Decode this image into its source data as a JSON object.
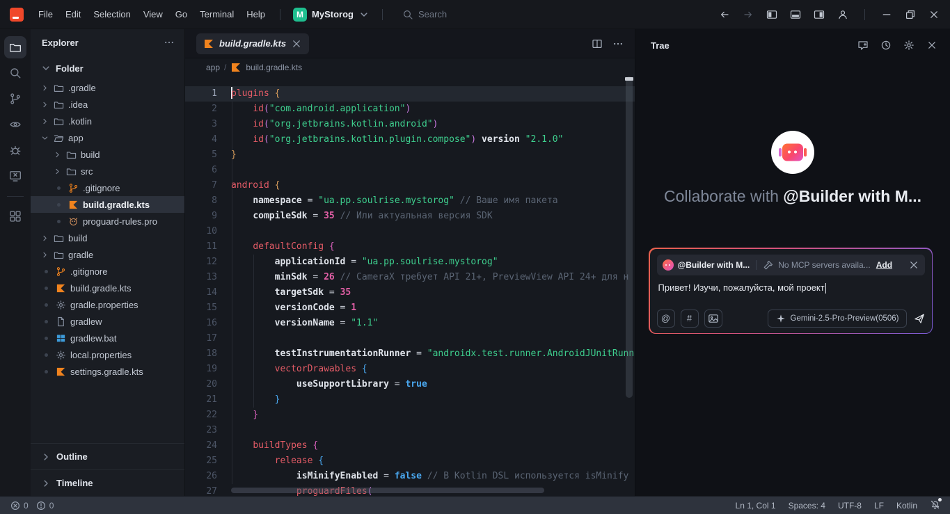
{
  "colors": {
    "accent_green": "#1fbf8f",
    "logo_red": "#f0482a",
    "kotlin_orange": "#f0831e",
    "windows_blue": "#3d9bd9",
    "input_border_gradient": [
      "#e8604c",
      "#d5527c",
      "#7a5bd6"
    ],
    "syntax": {
      "keyword": "#e35b66",
      "property": "#dfe3ea",
      "string": "#3ecf8e",
      "number": "#e25fa6",
      "comment": "#5a6473",
      "boolean": "#4aa8f0",
      "brace_level1": "#d49a5a",
      "brace_level2": "#d45fb8",
      "brace_level3": "#4aa8f0",
      "paren": "#c678dd"
    }
  },
  "titlebar": {
    "menus": [
      "File",
      "Edit",
      "Selection",
      "View",
      "Go",
      "Terminal",
      "Help"
    ],
    "project_badge": "M",
    "project_name": "MyStorog",
    "search_placeholder": "Search"
  },
  "activity_bar": {
    "items": [
      {
        "icon": "files-icon",
        "active": true
      },
      {
        "icon": "search-icon",
        "active": false
      },
      {
        "icon": "source-control-icon",
        "active": false
      },
      {
        "icon": "remote-eye-icon",
        "active": false
      },
      {
        "icon": "debug-icon",
        "active": false
      },
      {
        "icon": "test-screen-icon",
        "active": false
      },
      {
        "icon": "extensions-icon",
        "active": false,
        "below_divider": true
      }
    ]
  },
  "explorer": {
    "title": "Explorer",
    "section_label": "Folder",
    "items": [
      {
        "label": ".gradle",
        "icon": "folder",
        "level": 0,
        "kind": "folder"
      },
      {
        "label": ".idea",
        "icon": "folder",
        "level": 0,
        "kind": "folder"
      },
      {
        "label": ".kotlin",
        "icon": "folder",
        "level": 0,
        "kind": "folder"
      },
      {
        "label": "app",
        "icon": "folder-open",
        "level": 0,
        "kind": "folder",
        "expanded": true
      },
      {
        "label": "build",
        "icon": "folder",
        "level": 1,
        "kind": "folder"
      },
      {
        "label": "src",
        "icon": "folder",
        "level": 1,
        "kind": "folder"
      },
      {
        "label": ".gitignore",
        "icon": "git",
        "level": 1,
        "kind": "file"
      },
      {
        "label": "build.gradle.kts",
        "icon": "kotlin",
        "level": 1,
        "kind": "file",
        "selected": true
      },
      {
        "label": "proguard-rules.pro",
        "icon": "owl",
        "level": 1,
        "kind": "file"
      },
      {
        "label": "build",
        "icon": "folder",
        "level": 0,
        "kind": "folder"
      },
      {
        "label": "gradle",
        "icon": "folder",
        "level": 0,
        "kind": "folder"
      },
      {
        "label": ".gitignore",
        "icon": "git",
        "level": 0,
        "kind": "file"
      },
      {
        "label": "build.gradle.kts",
        "icon": "kotlin",
        "level": 0,
        "kind": "file"
      },
      {
        "label": "gradle.properties",
        "icon": "gear",
        "level": 0,
        "kind": "file"
      },
      {
        "label": "gradlew",
        "icon": "file",
        "level": 0,
        "kind": "file"
      },
      {
        "label": "gradlew.bat",
        "icon": "windows",
        "level": 0,
        "kind": "file"
      },
      {
        "label": "local.properties",
        "icon": "gear",
        "level": 0,
        "kind": "file"
      },
      {
        "label": "settings.gradle.kts",
        "icon": "kotlin",
        "level": 0,
        "kind": "file"
      }
    ],
    "outline_label": "Outline",
    "timeline_label": "Timeline"
  },
  "editor": {
    "tab_label": "build.gradle.kts",
    "breadcrumb_folder": "app",
    "breadcrumb_file": "build.gradle.kts",
    "lines": [
      {
        "n": 1,
        "current": true,
        "tokens": [
          [
            "kw",
            "plugins"
          ],
          [
            "txt",
            " "
          ],
          [
            "b1",
            "{"
          ]
        ]
      },
      {
        "n": 2,
        "tokens": [
          [
            "txt",
            "    "
          ],
          [
            "kw",
            "id"
          ],
          [
            "par",
            "("
          ],
          [
            "str",
            "\"com.android.application\""
          ],
          [
            "par",
            ")"
          ]
        ]
      },
      {
        "n": 3,
        "tokens": [
          [
            "txt",
            "    "
          ],
          [
            "kw",
            "id"
          ],
          [
            "par",
            "("
          ],
          [
            "str",
            "\"org.jetbrains.kotlin.android\""
          ],
          [
            "par",
            ")"
          ]
        ]
      },
      {
        "n": 4,
        "tokens": [
          [
            "txt",
            "    "
          ],
          [
            "kw",
            "id"
          ],
          [
            "par",
            "("
          ],
          [
            "str",
            "\"org.jetbrains.kotlin.plugin.compose\""
          ],
          [
            "par",
            ")"
          ],
          [
            "txt",
            " "
          ],
          [
            "prop",
            "version"
          ],
          [
            "txt",
            " "
          ],
          [
            "str",
            "\"2.1.0\""
          ]
        ]
      },
      {
        "n": 5,
        "tokens": [
          [
            "b1",
            "}"
          ]
        ]
      },
      {
        "n": 6,
        "tokens": []
      },
      {
        "n": 7,
        "tokens": [
          [
            "kw",
            "android"
          ],
          [
            "txt",
            " "
          ],
          [
            "b1",
            "{"
          ]
        ]
      },
      {
        "n": 8,
        "tokens": [
          [
            "txt",
            "    "
          ],
          [
            "prop",
            "namespace"
          ],
          [
            "pun",
            " = "
          ],
          [
            "str",
            "\"ua.pp.soulrise.mystorog\""
          ],
          [
            "txt",
            " "
          ],
          [
            "com",
            "// Ваше имя пакета"
          ]
        ]
      },
      {
        "n": 9,
        "tokens": [
          [
            "txt",
            "    "
          ],
          [
            "prop",
            "compileSdk"
          ],
          [
            "pun",
            " = "
          ],
          [
            "num",
            "35"
          ],
          [
            "txt",
            " "
          ],
          [
            "com",
            "// Или актуальная версия SDK"
          ]
        ]
      },
      {
        "n": 10,
        "tokens": []
      },
      {
        "n": 11,
        "tokens": [
          [
            "txt",
            "    "
          ],
          [
            "kw",
            "defaultConfig"
          ],
          [
            "txt",
            " "
          ],
          [
            "b2",
            "{"
          ]
        ]
      },
      {
        "n": 12,
        "tokens": [
          [
            "txt",
            "        "
          ],
          [
            "prop",
            "applicationId"
          ],
          [
            "pun",
            " = "
          ],
          [
            "str",
            "\"ua.pp.soulrise.mystorog\""
          ]
        ]
      },
      {
        "n": 13,
        "tokens": [
          [
            "txt",
            "        "
          ],
          [
            "prop",
            "minSdk"
          ],
          [
            "pun",
            " = "
          ],
          [
            "num",
            "26"
          ],
          [
            "txt",
            " "
          ],
          [
            "com",
            "// CameraX требует API 21+, PreviewView API 24+ для н"
          ]
        ]
      },
      {
        "n": 14,
        "tokens": [
          [
            "txt",
            "        "
          ],
          [
            "prop",
            "targetSdk"
          ],
          [
            "pun",
            " = "
          ],
          [
            "num",
            "35"
          ]
        ]
      },
      {
        "n": 15,
        "tokens": [
          [
            "txt",
            "        "
          ],
          [
            "prop",
            "versionCode"
          ],
          [
            "pun",
            " = "
          ],
          [
            "num",
            "1"
          ]
        ]
      },
      {
        "n": 16,
        "tokens": [
          [
            "txt",
            "        "
          ],
          [
            "prop",
            "versionName"
          ],
          [
            "pun",
            " = "
          ],
          [
            "str",
            "\"1.1\""
          ]
        ]
      },
      {
        "n": 17,
        "tokens": []
      },
      {
        "n": 18,
        "tokens": [
          [
            "txt",
            "        "
          ],
          [
            "prop",
            "testInstrumentationRunner"
          ],
          [
            "pun",
            " = "
          ],
          [
            "str",
            "\"androidx.test.runner.AndroidJUnitRunner\""
          ]
        ]
      },
      {
        "n": 19,
        "tokens": [
          [
            "txt",
            "        "
          ],
          [
            "kw",
            "vectorDrawables"
          ],
          [
            "txt",
            " "
          ],
          [
            "b3",
            "{"
          ]
        ]
      },
      {
        "n": 20,
        "tokens": [
          [
            "txt",
            "            "
          ],
          [
            "prop",
            "useSupportLibrary"
          ],
          [
            "pun",
            " = "
          ],
          [
            "bool",
            "true"
          ]
        ]
      },
      {
        "n": 21,
        "tokens": [
          [
            "txt",
            "        "
          ],
          [
            "b3",
            "}"
          ]
        ]
      },
      {
        "n": 22,
        "tokens": [
          [
            "txt",
            "    "
          ],
          [
            "b2",
            "}"
          ]
        ]
      },
      {
        "n": 23,
        "tokens": []
      },
      {
        "n": 24,
        "tokens": [
          [
            "txt",
            "    "
          ],
          [
            "kw",
            "buildTypes"
          ],
          [
            "txt",
            " "
          ],
          [
            "b2",
            "{"
          ]
        ]
      },
      {
        "n": 25,
        "tokens": [
          [
            "txt",
            "        "
          ],
          [
            "kw",
            "release"
          ],
          [
            "txt",
            " "
          ],
          [
            "b3",
            "{"
          ]
        ]
      },
      {
        "n": 26,
        "tokens": [
          [
            "txt",
            "            "
          ],
          [
            "prop",
            "isMinifyEnabled"
          ],
          [
            "pun",
            " = "
          ],
          [
            "bool",
            "false"
          ],
          [
            "txt",
            " "
          ],
          [
            "com",
            "// В Kotlin DSL используется isMinify"
          ]
        ]
      },
      {
        "n": 27,
        "tokens": [
          [
            "txt",
            "            "
          ],
          [
            "kw",
            "proguardFiles"
          ],
          [
            "par",
            "("
          ]
        ]
      }
    ]
  },
  "trae_panel": {
    "title": "Trae",
    "heading_prefix": "Collaborate with ",
    "heading_agent": "@Builder with M...",
    "input": {
      "agent_label": "@Builder with M...",
      "mcp_label": "No MCP servers availa...",
      "add_label": "Add",
      "message": "Привет! Изучи, пожалуйста, мой проект",
      "model_label": "Gemini-2.5-Pro-Preview(0506)"
    }
  },
  "statusbar": {
    "error_count": "0",
    "warning_count": "0",
    "right_items": [
      "Ln 1, Col 1",
      "Spaces: 4",
      "UTF-8",
      "LF",
      "Kotlin"
    ]
  }
}
